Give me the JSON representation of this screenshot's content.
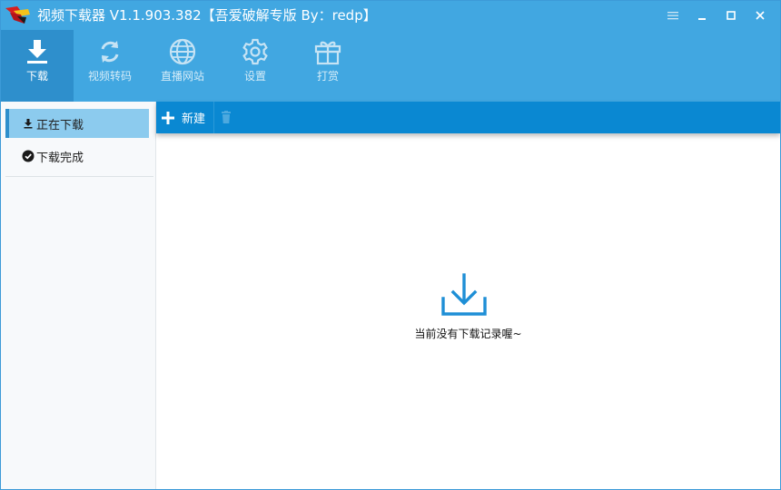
{
  "window": {
    "title": "视频下载器 V1.1.903.382【吾爱破解专版 By：redp】"
  },
  "colors": {
    "header": "#41a7e1",
    "tool_active": "#2e8fcc",
    "action_bar": "#0a88d2",
    "sidebar_active": "#8ccbee",
    "empty_icon": "#1e8fd6"
  },
  "toolbar": {
    "items": [
      {
        "label": "下载",
        "icon": "download-icon"
      },
      {
        "label": "视频转码",
        "icon": "refresh-icon"
      },
      {
        "label": "直播网站",
        "icon": "globe-icon"
      },
      {
        "label": "设置",
        "icon": "gear-icon"
      },
      {
        "label": "打赏",
        "icon": "gift-icon"
      }
    ]
  },
  "sidebar": {
    "items": [
      {
        "label": "正在下载",
        "icon": "download-icon"
      },
      {
        "label": "下载完成",
        "icon": "check-circle-icon"
      }
    ]
  },
  "actions": {
    "new_label": "新建"
  },
  "main": {
    "empty_text": "当前没有下载记录喔~"
  }
}
